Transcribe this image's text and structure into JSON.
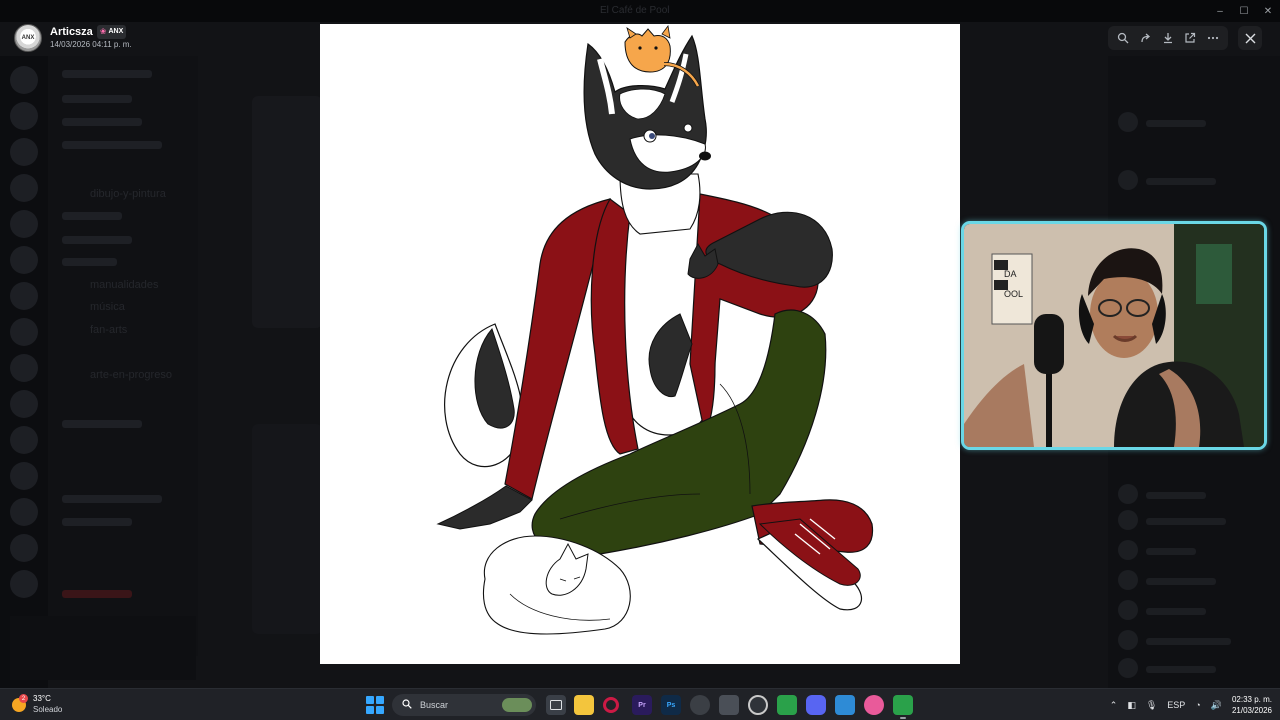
{
  "window": {
    "title": "El Café de Pool"
  },
  "uploader": {
    "name": "Articsza",
    "tag": "ANX",
    "timestamp": "14/03/2026 04:11 p. m."
  },
  "viewer_toolbar": {
    "icons": [
      "zoom-icon",
      "forward-icon",
      "download-icon",
      "open-external-icon",
      "more-icon"
    ],
    "close_icon": "close-icon"
  },
  "background_channels": [
    "dibujo-y-pintura",
    "fan-arts",
    "manualidades",
    "música",
    "arte-en-progreso"
  ],
  "taskbar": {
    "weather": {
      "temp": "33°C",
      "condition": "Soleado",
      "badge": "2"
    },
    "search_placeholder": "Buscar",
    "apps": [
      {
        "name": "file-explorer-app",
        "label": "",
        "color": "#f3c53d"
      },
      {
        "name": "opera-app",
        "label": "O",
        "color": "#cc1a45"
      },
      {
        "name": "premiere-app",
        "label": "Pr",
        "color": "#2a1b5c"
      },
      {
        "name": "photoshop-app",
        "label": "Ps",
        "color": "#0f2a47"
      },
      {
        "name": "discord-app",
        "label": "",
        "color": "#5865f2"
      }
    ],
    "tray": {
      "language": "ESP",
      "time": "02:33 p. m.",
      "date": "21/03/2026"
    }
  }
}
